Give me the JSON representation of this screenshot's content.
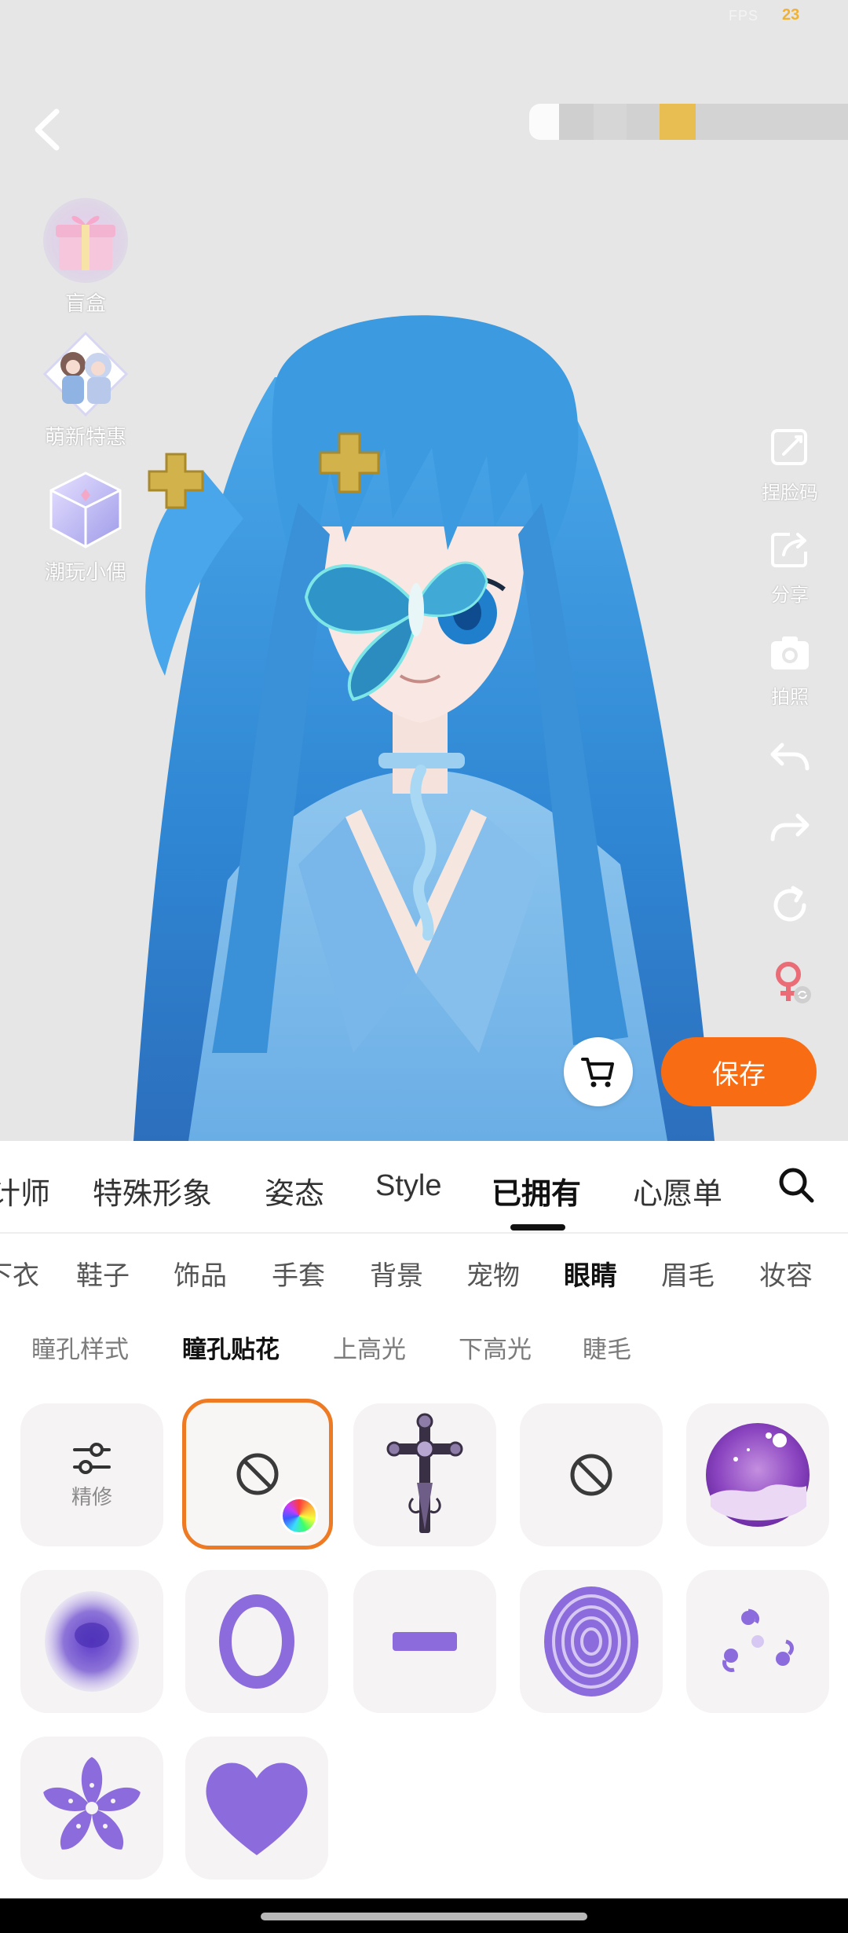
{
  "status": {
    "fps_label": "FPS",
    "fps_value": "23"
  },
  "left_promos": [
    {
      "label": "盲盒",
      "icon": "gift-box-icon"
    },
    {
      "label": "萌新特惠",
      "icon": "newbie-deal-icon"
    },
    {
      "label": "潮玩小偶",
      "icon": "figure-box-icon"
    }
  ],
  "right_tools": [
    {
      "label": "捏脸码",
      "icon": "face-code-icon"
    },
    {
      "label": "分享",
      "icon": "share-icon"
    },
    {
      "label": "拍照",
      "icon": "camera-icon"
    }
  ],
  "actions": {
    "save_label": "保存"
  },
  "main_tabs": [
    "计师",
    "特殊形象",
    "姿态",
    "Style",
    "已拥有",
    "心愿单"
  ],
  "main_tab_active": "已拥有",
  "sub_tabs": [
    "下衣",
    "鞋子",
    "饰品",
    "手套",
    "背景",
    "宠物",
    "眼睛",
    "眉毛",
    "妆容"
  ],
  "sub_tab_active": "眼睛",
  "third_tabs": [
    "瞳孔样式",
    "瞳孔贴花",
    "上高光",
    "下高光",
    "睫毛"
  ],
  "third_tab_active": "瞳孔贴花",
  "items": [
    {
      "type": "refine",
      "label": "精修"
    },
    {
      "type": "none",
      "selected": true
    },
    {
      "type": "cross"
    },
    {
      "type": "none"
    },
    {
      "type": "galaxy"
    },
    {
      "type": "smoke"
    },
    {
      "type": "ring"
    },
    {
      "type": "dash"
    },
    {
      "type": "spiral"
    },
    {
      "type": "tomoe"
    },
    {
      "type": "sakura"
    },
    {
      "type": "heart"
    }
  ],
  "colors": {
    "accent": "#f86d13",
    "selected_border": "#ee7a23",
    "decal_purple": "#8c6cdc"
  }
}
